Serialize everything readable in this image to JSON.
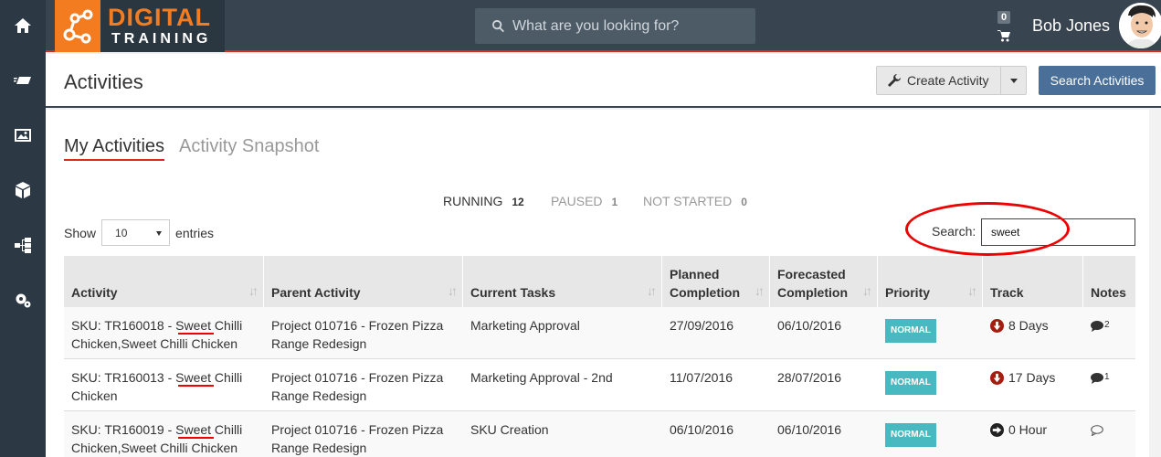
{
  "sidebar": {
    "icons": [
      "home-icon",
      "delivery-icon",
      "image-icon",
      "box-icon",
      "hierarchy-icon",
      "settings-gears-icon"
    ]
  },
  "topbar": {
    "logo_line1": "DIGITAL",
    "logo_line2": "TRAINING",
    "search_placeholder": "What are you looking for?",
    "cart_count": "0",
    "user_name": "Bob Jones"
  },
  "header": {
    "title": "Activities",
    "create_label": "Create Activity",
    "search_label": "Search Activities"
  },
  "tabs": {
    "active": "My Activities",
    "inactive": "Activity Snapshot"
  },
  "status": {
    "running_label": "RUNNING",
    "running_count": "12",
    "paused_label": "PAUSED",
    "paused_count": "1",
    "notstarted_label": "NOT STARTED",
    "notstarted_count": "0"
  },
  "controls": {
    "show_label": "Show",
    "entries_value": "10",
    "entries_label": "entries",
    "search_label": "Search:",
    "search_value": "sweet"
  },
  "table": {
    "headers": {
      "activity": "Activity",
      "parent": "Parent Activity",
      "tasks": "Current Tasks",
      "planned_1": "Planned",
      "planned_2": "Completion",
      "forecast_1": "Forecasted",
      "forecast_2": "Completion",
      "priority": "Priority",
      "track": "Track",
      "notes": "Notes"
    },
    "rows": [
      {
        "activity_1": "SKU: TR160018 - Sweet Chilli",
        "activity_2": "Chicken,Sweet Chilli Chicken",
        "parent_1": "Project 010716 - Frozen Pizza",
        "parent_2": "Range Redesign",
        "tasks": "Marketing Approval",
        "planned": "27/09/2016",
        "forecast": "06/10/2016",
        "priority": "NORMAL",
        "track": "8 Days",
        "notes": "2"
      },
      {
        "activity_1": "SKU: TR160013 - Sweet Chilli",
        "activity_2": "Chicken",
        "parent_1": "Project 010716 - Frozen Pizza",
        "parent_2": "Range Redesign",
        "tasks": "Marketing Approval - 2nd",
        "planned": "11/07/2016",
        "forecast": "28/07/2016",
        "priority": "NORMAL",
        "track": "17 Days",
        "notes": "1"
      },
      {
        "activity_1": "SKU: TR160019 - Sweet Chilli",
        "activity_2": "Chicken,Sweet Chilli Chicken",
        "parent_1": "Project 010716 - Frozen Pizza",
        "parent_2": "Range Redesign",
        "tasks": "SKU Creation",
        "planned": "06/10/2016",
        "forecast": "06/10/2016",
        "priority": "NORMAL",
        "track": "0 Hour",
        "notes": ""
      }
    ]
  },
  "colors": {
    "accent_red": "#d62d20",
    "brand_orange": "#f47c20",
    "priority_teal": "#48b9c0",
    "primary_blue": "#4a6f99"
  }
}
